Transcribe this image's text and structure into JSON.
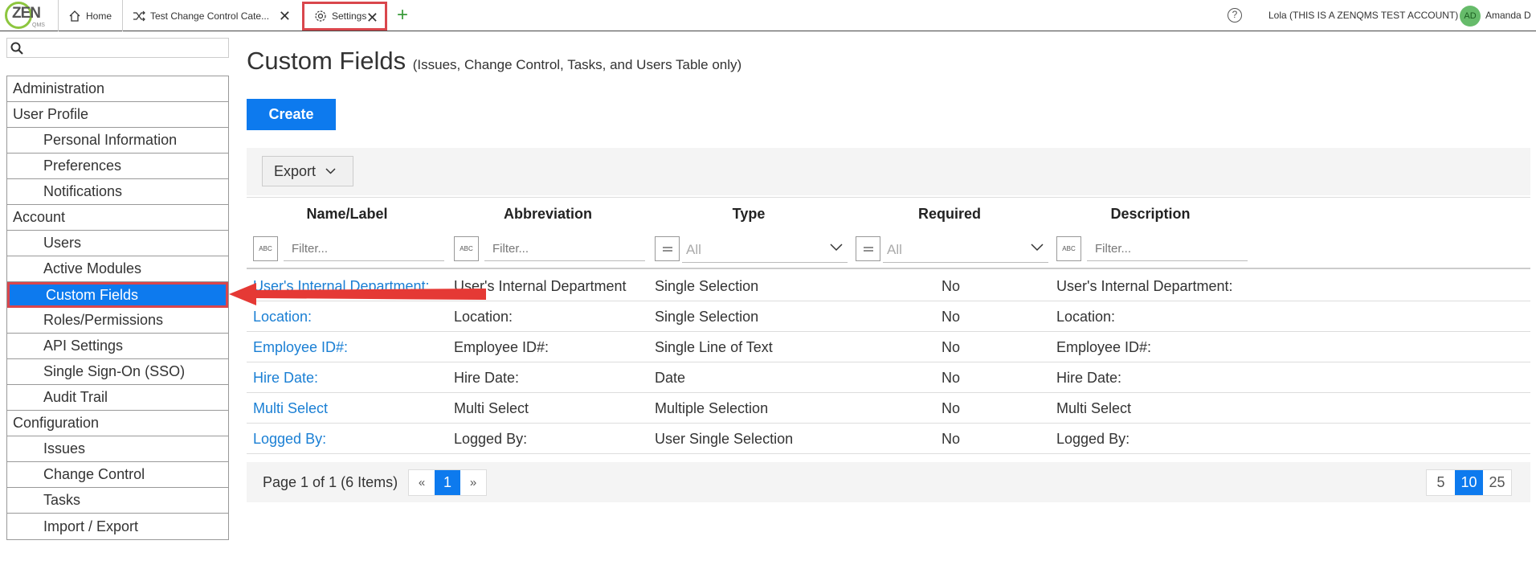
{
  "topbar": {
    "logo_text": "ZEN",
    "logo_sub": "QMS",
    "tabs": [
      {
        "label": "Home"
      },
      {
        "label": "Test Change Control Cate..."
      },
      {
        "label": "Settings"
      }
    ],
    "account_text": "Lola (THIS IS A ZENQMS TEST ACCOUNT)",
    "avatar_initials": "AD",
    "user_name": "Amanda D"
  },
  "sidebar": {
    "items": [
      {
        "label": "Administration"
      },
      {
        "label": "User Profile"
      },
      {
        "label": "Personal Information"
      },
      {
        "label": "Preferences"
      },
      {
        "label": "Notifications"
      },
      {
        "label": "Account"
      },
      {
        "label": "Users"
      },
      {
        "label": "Active Modules"
      },
      {
        "label": "Custom Fields"
      },
      {
        "label": "Roles/Permissions"
      },
      {
        "label": "API Settings"
      },
      {
        "label": "Single Sign-On (SSO)"
      },
      {
        "label": "Audit Trail"
      },
      {
        "label": "Configuration"
      },
      {
        "label": "Issues"
      },
      {
        "label": "Change Control"
      },
      {
        "label": "Tasks"
      },
      {
        "label": "Import / Export"
      }
    ]
  },
  "main": {
    "title": "Custom Fields",
    "subtitle": "(Issues, Change Control, Tasks, and Users Table only)",
    "create_label": "Create",
    "export_label": "Export",
    "columns": [
      "Name/Label",
      "Abbreviation",
      "Type",
      "Required",
      "Description"
    ],
    "filter_placeholder": "Filter...",
    "select_all": "All",
    "rows": [
      [
        "User's Internal Department:",
        "User's Internal Department",
        "Single Selection",
        "No",
        "User's Internal Department:"
      ],
      [
        "Location:",
        "Location:",
        "Single Selection",
        "No",
        "Location:"
      ],
      [
        "Employee ID#:",
        "Employee ID#:",
        "Single Line of Text",
        "No",
        "Employee ID#:"
      ],
      [
        "Hire Date:",
        "Hire Date:",
        "Date",
        "No",
        "Hire Date:"
      ],
      [
        "Multi Select",
        "Multi Select",
        "Multiple Selection",
        "No",
        "Multi Select"
      ],
      [
        "Logged By:",
        "Logged By:",
        "User Single Selection",
        "No",
        "Logged By:"
      ]
    ],
    "pager": {
      "info": "Page 1 of 1 (6 Items)",
      "prev": "«",
      "current": "1",
      "next": "»",
      "sizes": [
        "5",
        "10",
        "25"
      ]
    }
  },
  "colors": {
    "accent": "#0d7aee",
    "highlight": "#d9464c",
    "link": "#1a7fd4"
  }
}
